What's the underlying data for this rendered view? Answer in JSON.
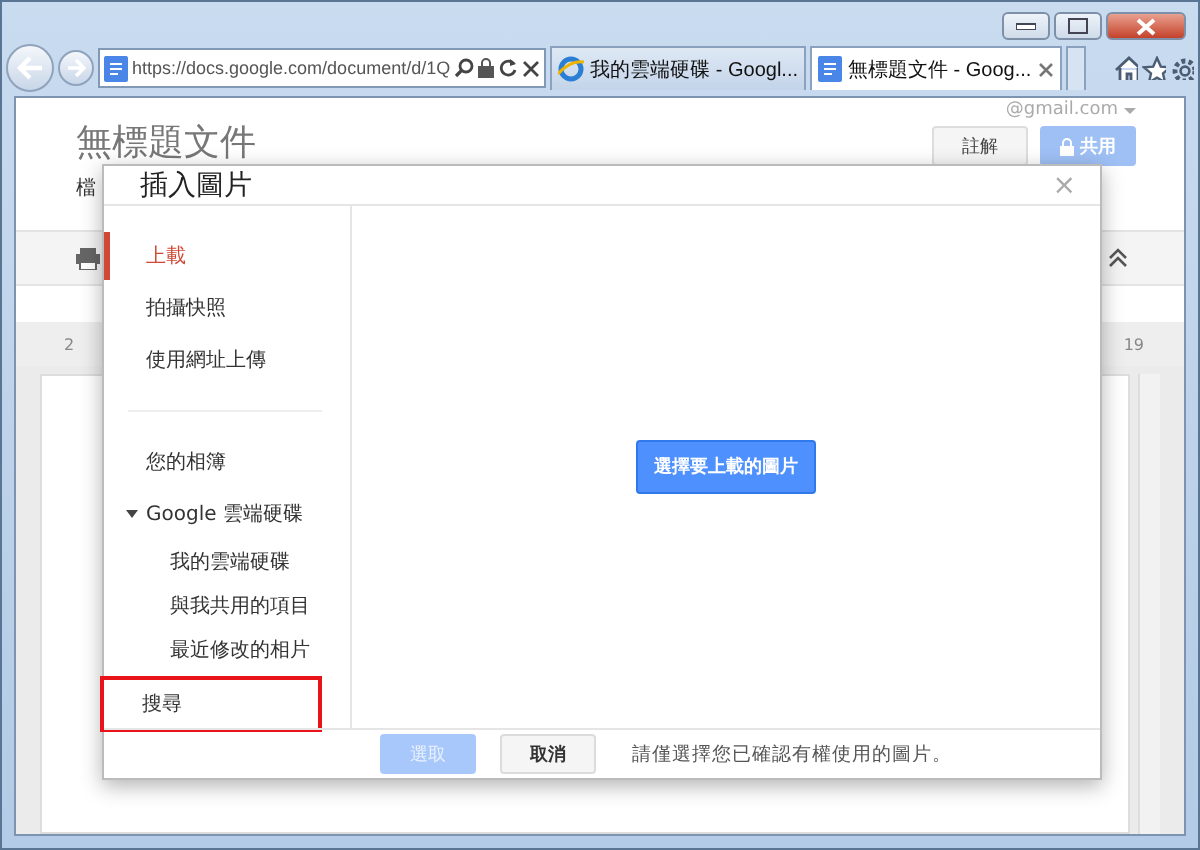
{
  "browser": {
    "address": "https://docs.google.com/document/d/1Q",
    "tabs": [
      {
        "title": "我的雲端硬碟 - Googl...",
        "selected": false
      },
      {
        "title": "無標題文件 - Goog...",
        "selected": true
      }
    ]
  },
  "docs": {
    "account": "@gmail.com",
    "title": "無標題文件",
    "menu_fragment": "檔",
    "buttons": [
      {
        "label": "註解",
        "kind": "default"
      },
      {
        "label": "共用",
        "kind": "primary"
      }
    ],
    "ruler": [
      "2",
      "19"
    ]
  },
  "dialog": {
    "title": "插入圖片",
    "close": "×",
    "nav": [
      {
        "label": "上載",
        "selected": true,
        "highlighted": false
      },
      {
        "label": "拍攝快照",
        "selected": false,
        "highlighted": false
      },
      {
        "label": "使用網址上傳",
        "selected": false,
        "highlighted": false
      },
      {
        "kind": "divider"
      },
      {
        "label": "您的相簿",
        "selected": false,
        "highlighted": false
      },
      {
        "label": "Google 雲端硬碟",
        "selected": false,
        "highlighted": false,
        "expanded": true,
        "children": [
          {
            "label": "我的雲端硬碟",
            "selected": false,
            "highlighted": false
          },
          {
            "label": "與我共用的項目",
            "selected": false,
            "highlighted": false
          },
          {
            "label": "最近修改的相片",
            "selected": false,
            "highlighted": false
          }
        ]
      },
      {
        "label": "搜尋",
        "selected": false,
        "highlighted": true
      }
    ],
    "upload_button": "選擇要上載的圖片",
    "select_button": {
      "label": "選取",
      "disabled": true
    },
    "cancel_button": "取消",
    "note": "請僅選擇您已確認有權使用的圖片。"
  }
}
